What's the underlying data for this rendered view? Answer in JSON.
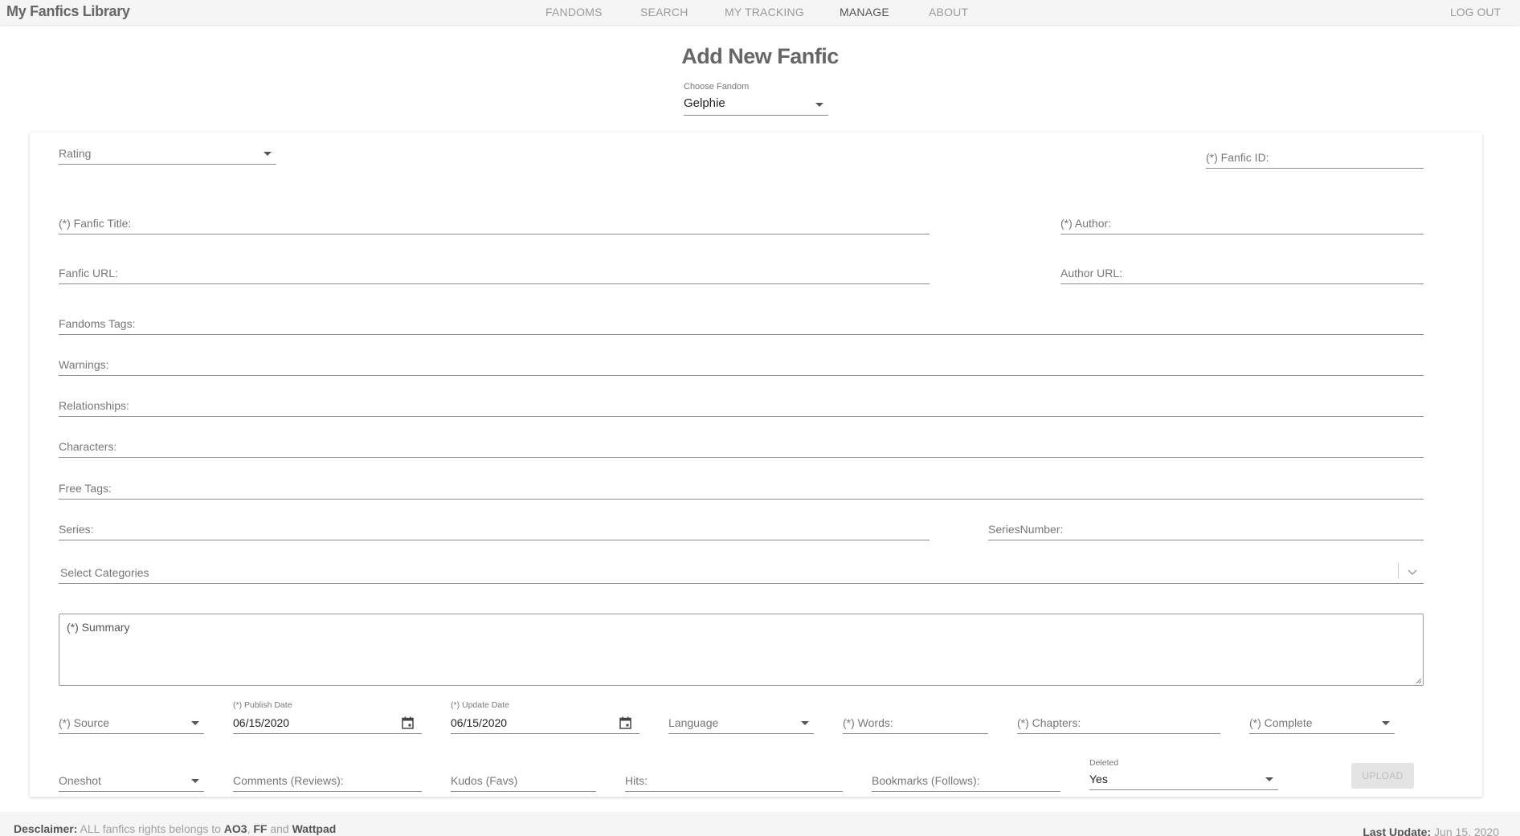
{
  "nav": {
    "brand": "My Fanfics Library",
    "items": [
      "FANDOMS",
      "SEARCH",
      "MY TRACKING",
      "MANAGE",
      "ABOUT"
    ],
    "active": "MANAGE",
    "logout": "LOG OUT"
  },
  "page": {
    "title": "Add New Fanfic",
    "fandom_label": "Choose Fandom",
    "fandom_value": "Gelphie"
  },
  "form": {
    "rating": "Rating",
    "fanfic_id": "(*) Fanfic ID:",
    "fanfic_title": "(*) Fanfic Title:",
    "author": "(*) Author:",
    "fanfic_url": "Fanfic URL:",
    "author_url": "Author URL:",
    "fandoms_tags": "Fandoms Tags:",
    "warnings": "Warnings:",
    "relationships": "Relationships:",
    "characters": "Characters:",
    "free_tags": "Free Tags:",
    "series": "Series:",
    "series_number": "SeriesNumber:",
    "categories": "Select Categories",
    "summary": "(*) Summary",
    "source": "(*) Source",
    "publish_label": "(*) Publish Date",
    "publish_value": "06/15/2020",
    "update_label": "(*) Update Date",
    "update_value": "06/15/2020",
    "language": "Language",
    "words": "(*) Words:",
    "chapters": "(*) Chapters:",
    "complete": "(*) Complete",
    "oneshot": "Oneshot",
    "comments": "Comments (Reviews):",
    "kudos": "Kudos (Favs)",
    "hits": "Hits:",
    "bookmarks": "Bookmarks (Follows):",
    "deleted_label": "Deleted",
    "deleted_value": "Yes",
    "upload": "UPLOAD"
  },
  "footer": {
    "disclaimer_label": "Desclaimer:",
    "disclaimer_text": "ALL fanfics rights belongs to",
    "site1": "AO3",
    "comma": ",",
    "site2": "FF",
    "and": "and",
    "site3": "Wattpad",
    "last_update_label": "Last Update:",
    "last_update_value": "Jun 15, 2020"
  },
  "colors": {
    "nav_bg": "#f5f5f5",
    "text_muted": "#9a9a9a",
    "underline": "#8a8a8a"
  }
}
